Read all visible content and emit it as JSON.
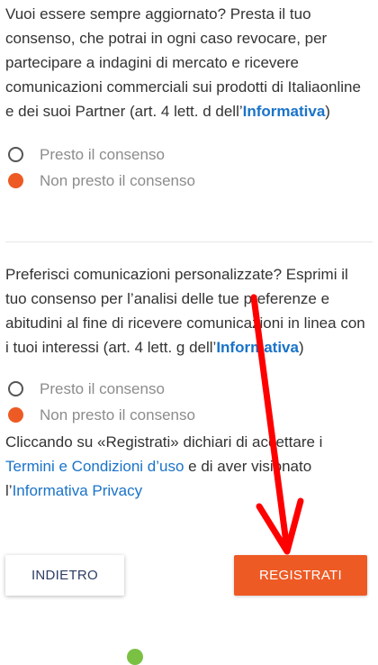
{
  "section1": {
    "text": "Vuoi essere sempre aggiornato? Presta il tuo consenso, che potrai in ogni caso revocare, per partecipare a indagini di mercato e ricevere comunicazioni commerciali sui prodotti di Italiaonline e dei suoi Partner (art. 4 lett. d dell’",
    "link": "Informativa",
    "suffix": ")",
    "option_yes": "Presto il consenso",
    "option_no": "Non presto il consenso",
    "selected": "no"
  },
  "section2": {
    "text": "Preferisci comunicazioni personalizzate? Esprimi il tuo consenso per l’analisi delle tue preferenze e abitudini al fine di ricevere comunicazioni in linea con i tuoi interessi (art. 4 lett. g dell’",
    "link": "Informativa",
    "suffix": ")",
    "option_yes": "Presto il consenso",
    "option_no": "Non presto il consenso",
    "selected": "no"
  },
  "terms": {
    "prefix": "Cliccando su «Registrati» dichiari di accettare i ",
    "terms_link": "Termini e Condizioni d’uso",
    "middle": " e di aver visionato l’",
    "privacy_link": "Informativa Privacy"
  },
  "buttons": {
    "back_label": "INDIETRO",
    "register_label": "REGISTRATI"
  },
  "colors": {
    "accent": "#ee5a24",
    "link": "#1a73c9",
    "annotation_arrow": "#ff0000"
  }
}
